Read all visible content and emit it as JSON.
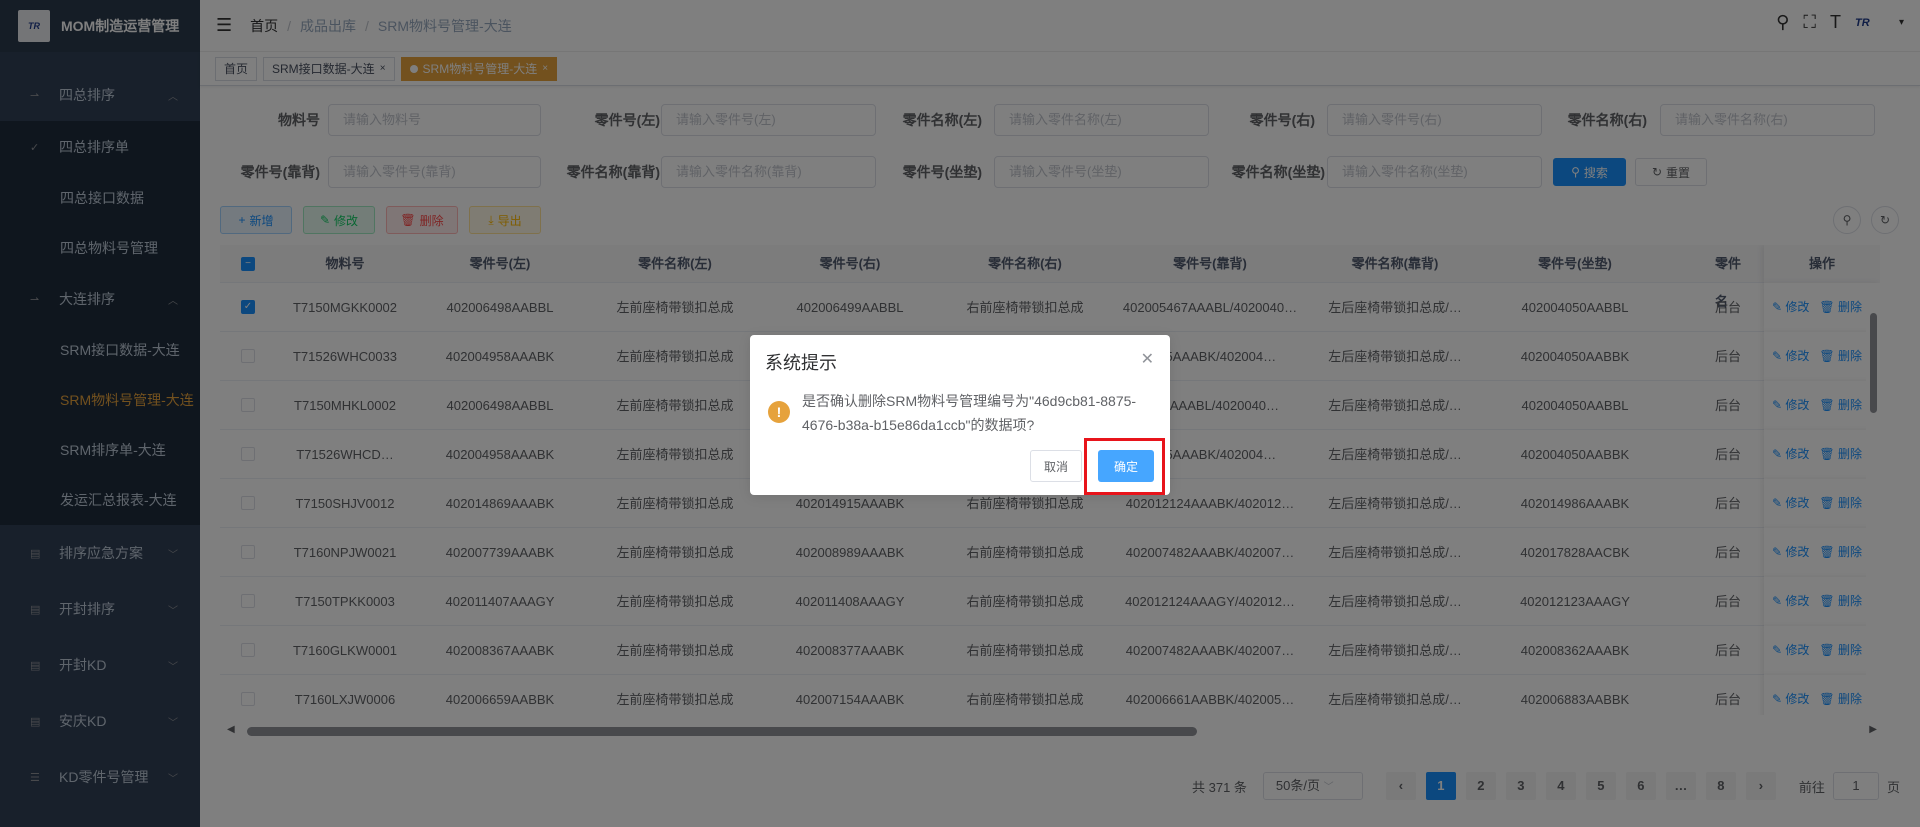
{
  "app": {
    "title": "MOM制造运营管理",
    "logo_text": "TR"
  },
  "sidebar": {
    "items": [
      {
        "label": "四总排序",
        "icon": "sort-icon",
        "expanded": true
      },
      {
        "label": "四总排序单",
        "icon": "check-icon"
      },
      {
        "label": "四总接口数据",
        "sub": true
      },
      {
        "label": "四总物料号管理",
        "sub": true
      },
      {
        "label": "大连排序",
        "icon": "sort-icon",
        "expanded": true
      },
      {
        "label": "SRM接口数据-大连",
        "sub": true
      },
      {
        "label": "SRM物料号管理-大连",
        "sub": true,
        "active": true
      },
      {
        "label": "SRM排序单-大连",
        "sub": true
      },
      {
        "label": "发运汇总报表-大连",
        "sub": true
      },
      {
        "label": "排序应急方案",
        "icon": "table-icon"
      },
      {
        "label": "开封排序",
        "icon": "table-icon"
      },
      {
        "label": "开封KD",
        "icon": "table-icon"
      },
      {
        "label": "安庆KD",
        "icon": "table-icon"
      },
      {
        "label": "KD零件号管理",
        "icon": "list-icon"
      }
    ]
  },
  "navbar": {
    "breadcrumb": [
      "首页",
      "成品出库",
      "SRM物料号管理-大连"
    ]
  },
  "tags": [
    {
      "label": "首页"
    },
    {
      "label": "SRM接口数据-大连"
    },
    {
      "label": "SRM物料号管理-大连",
      "active": true
    }
  ],
  "form": {
    "fields": [
      {
        "label": "物料号",
        "placeholder": "请输入物料号"
      },
      {
        "label": "零件号(左)",
        "placeholder": "请输入零件号(左)"
      },
      {
        "label": "零件名称(左)",
        "placeholder": "请输入零件名称(左)"
      },
      {
        "label": "零件号(右)",
        "placeholder": "请输入零件号(右)"
      },
      {
        "label": "零件名称(右)",
        "placeholder": "请输入零件名称(右)"
      },
      {
        "label": "零件号(靠背)",
        "placeholder": "请输入零件号(靠背)"
      },
      {
        "label": "零件名称(靠背)",
        "placeholder": "请输入零件名称(靠背)"
      },
      {
        "label": "零件号(坐垫)",
        "placeholder": "请输入零件号(坐垫)"
      },
      {
        "label": "零件名称(坐垫)",
        "placeholder": "请输入零件名称(坐垫)"
      }
    ],
    "search": "搜索",
    "reset": "重置"
  },
  "toolbar": {
    "add": "新增",
    "edit": "修改",
    "delete": "删除",
    "export": "导出"
  },
  "table": {
    "columns": [
      "物料号",
      "零件号(左)",
      "零件名称(左)",
      "零件号(右)",
      "零件名称(右)",
      "零件号(靠背)",
      "零件名称(靠背)",
      "零件号(坐垫)",
      "零件名",
      "操作"
    ],
    "op_edit": "修改",
    "op_delete": "删除",
    "rows": [
      {
        "checked": true,
        "c": [
          "T7150MGKK0002",
          "402006498AABBL",
          "左前座椅带锁扣总成",
          "402006499AABBL",
          "右前座椅带锁扣总成",
          "402005467AAABL/4020040…",
          "左后座椅带锁扣总成/…",
          "402004050AABBL",
          "后台"
        ]
      },
      {
        "checked": false,
        "c": [
          "T71526WHC0033",
          "402004958AAABK",
          "左前座椅带锁扣总成",
          "",
          "",
          "5255AAABK/402004…",
          "左后座椅带锁扣总成/…",
          "402004050AABBK",
          "后台"
        ]
      },
      {
        "checked": false,
        "c": [
          "T7150MHKL0002",
          "402006498AABBL",
          "左前座椅带锁扣总成",
          "",
          "",
          "5467AAABL/4020040…",
          "左后座椅带锁扣总成/…",
          "402004050AABBL",
          "后台"
        ]
      },
      {
        "checked": false,
        "c": [
          "T71526WHCD…",
          "402004958AAABK",
          "左前座椅带锁扣总成",
          "",
          "",
          "5255AAABK/402004…",
          "左后座椅带锁扣总成/…",
          "402004050AABBK",
          "后台"
        ]
      },
      {
        "checked": false,
        "c": [
          "T7150SHJV0012",
          "402014869AAABK",
          "左前座椅带锁扣总成",
          "402014915AAABK",
          "右前座椅带锁扣总成",
          "402012124AAABK/402012…",
          "左后座椅带锁扣总成/…",
          "402014986AAABK",
          "后台"
        ]
      },
      {
        "checked": false,
        "c": [
          "T7160NPJW0021",
          "402007739AAABK",
          "左前座椅带锁扣总成",
          "402008989AAABK",
          "右前座椅带锁扣总成",
          "402007482AAABK/402007…",
          "左后座椅带锁扣总成/…",
          "402017828AACBK",
          "后台"
        ]
      },
      {
        "checked": false,
        "c": [
          "T7150TPKK0003",
          "402011407AAAGY",
          "左前座椅带锁扣总成",
          "402011408AAAGY",
          "右前座椅带锁扣总成",
          "402012124AAAGY/402012…",
          "左后座椅带锁扣总成/…",
          "402012123AAAGY",
          "后台"
        ]
      },
      {
        "checked": false,
        "c": [
          "T7160GLKW0001",
          "402008367AAABK",
          "左前座椅带锁扣总成",
          "402008377AAABK",
          "右前座椅带锁扣总成",
          "402007482AAABK/402007…",
          "左后座椅带锁扣总成/…",
          "402008362AAABK",
          "后台"
        ]
      },
      {
        "checked": false,
        "c": [
          "T7160LXJW0006",
          "402006659AABBK",
          "左前座椅带锁扣总成",
          "402007154AAABK",
          "右前座椅带锁扣总成",
          "402006661AABBK/402005…",
          "左后座椅带锁扣总成/…",
          "402006883AABBK",
          "后台"
        ]
      }
    ]
  },
  "pager": {
    "total": "共 371 条",
    "size": "50条/页",
    "pages": [
      "1",
      "2",
      "3",
      "4",
      "5",
      "6",
      "…",
      "8"
    ],
    "goto": "前往",
    "goto_value": "1",
    "page_unit": "页"
  },
  "dialog": {
    "title": "系统提示",
    "message": "是否确认删除SRM物料号管理编号为\"46d9cb81-8875-4676-b38a-b15e86da1ccb\"的数据项?",
    "cancel": "取消",
    "ok": "确定"
  }
}
